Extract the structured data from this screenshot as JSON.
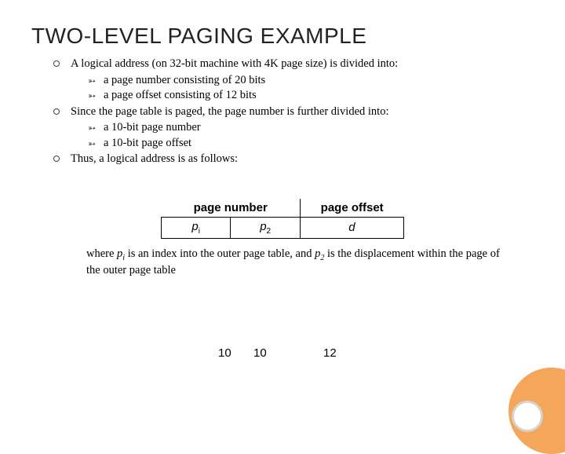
{
  "title": "TWO-LEVEL PAGING EXAMPLE",
  "bullets": {
    "b1": "A logical address (on 32-bit machine with 4K page size) is divided into:",
    "b1a": "a page number consisting of 20 bits",
    "b1b": "a page offset consisting of 12 bits",
    "b2": "Since the page table is paged, the page number is further divided into:",
    "b2a": "a 10-bit page number",
    "b2b": "a 10-bit page offset",
    "b3": "Thus, a logical address is as follows:"
  },
  "table": {
    "hdr_pn": "page number",
    "hdr_po": "page offset",
    "p1": "p",
    "p1s": "i",
    "p2": "p",
    "p2s": "2",
    "d": "d",
    "bits1": "10",
    "bits2": "10",
    "bits3": "12"
  },
  "caption": {
    "pre": "where ",
    "p1": "p",
    "p1s": "i",
    "mid1": " is an index into the outer page table, and ",
    "p2": "p",
    "p2s": "2",
    "mid2": " is the displacement within the page of the outer page table"
  }
}
